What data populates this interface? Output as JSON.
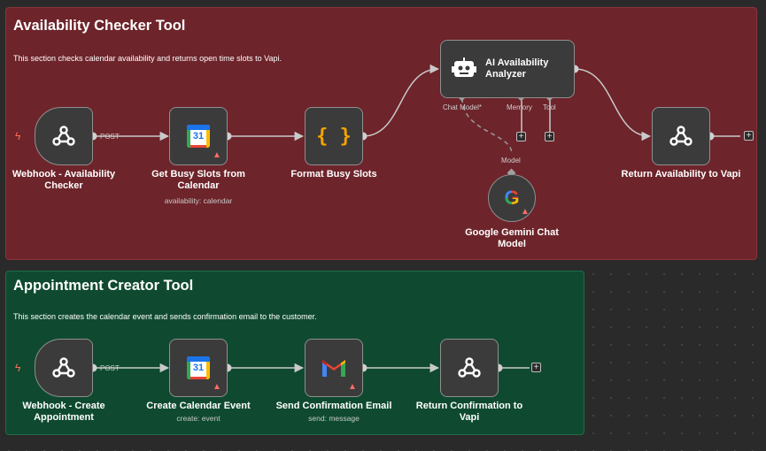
{
  "sections": {
    "availability": {
      "title": "Availability Checker Tool",
      "description": "This section checks calendar availability and returns open time slots to Vapi.",
      "color": "#6d242a"
    },
    "appointment": {
      "title": "Appointment Creator Tool",
      "description": "This section creates the calendar event and sends confirmation email to the customer.",
      "color": "#0f4a30"
    }
  },
  "nodes": {
    "webhook_availability": {
      "label": "Webhook - Availability Checker",
      "icon": "webhook-icon",
      "connector": "POST"
    },
    "get_busy_slots": {
      "label": "Get Busy Slots from Calendar",
      "subtitle": "availability: calendar",
      "icon": "google-calendar-icon",
      "badge": "31"
    },
    "format_busy_slots": {
      "label": "Format Busy Slots",
      "icon": "code-braces-icon",
      "glyph": "{ }"
    },
    "ai_analyzer": {
      "label": "AI Availability Analyzer",
      "icon": "robot-icon",
      "ports": {
        "chat_model": "Chat Model*",
        "memory": "Memory",
        "tool": "Tool"
      }
    },
    "gemini_model": {
      "label": "Google Gemini Chat Model",
      "icon": "google-g-icon",
      "port": "Model",
      "glyph": "G"
    },
    "return_availability": {
      "label": "Return Availability to Vapi",
      "icon": "webhook-icon"
    },
    "webhook_create": {
      "label": "Webhook - Create Appointment",
      "icon": "webhook-icon",
      "connector": "POST"
    },
    "create_event": {
      "label": "Create Calendar Event",
      "subtitle": "create: event",
      "icon": "google-calendar-icon",
      "badge": "31"
    },
    "send_email": {
      "label": "Send Confirmation Email",
      "subtitle": "send: message",
      "icon": "gmail-icon"
    },
    "return_confirmation": {
      "label": "Return Confirmation to Vapi",
      "icon": "webhook-icon"
    }
  },
  "glyphs": {
    "plus": "+",
    "warning": "▲",
    "bolt": "ϟ"
  }
}
